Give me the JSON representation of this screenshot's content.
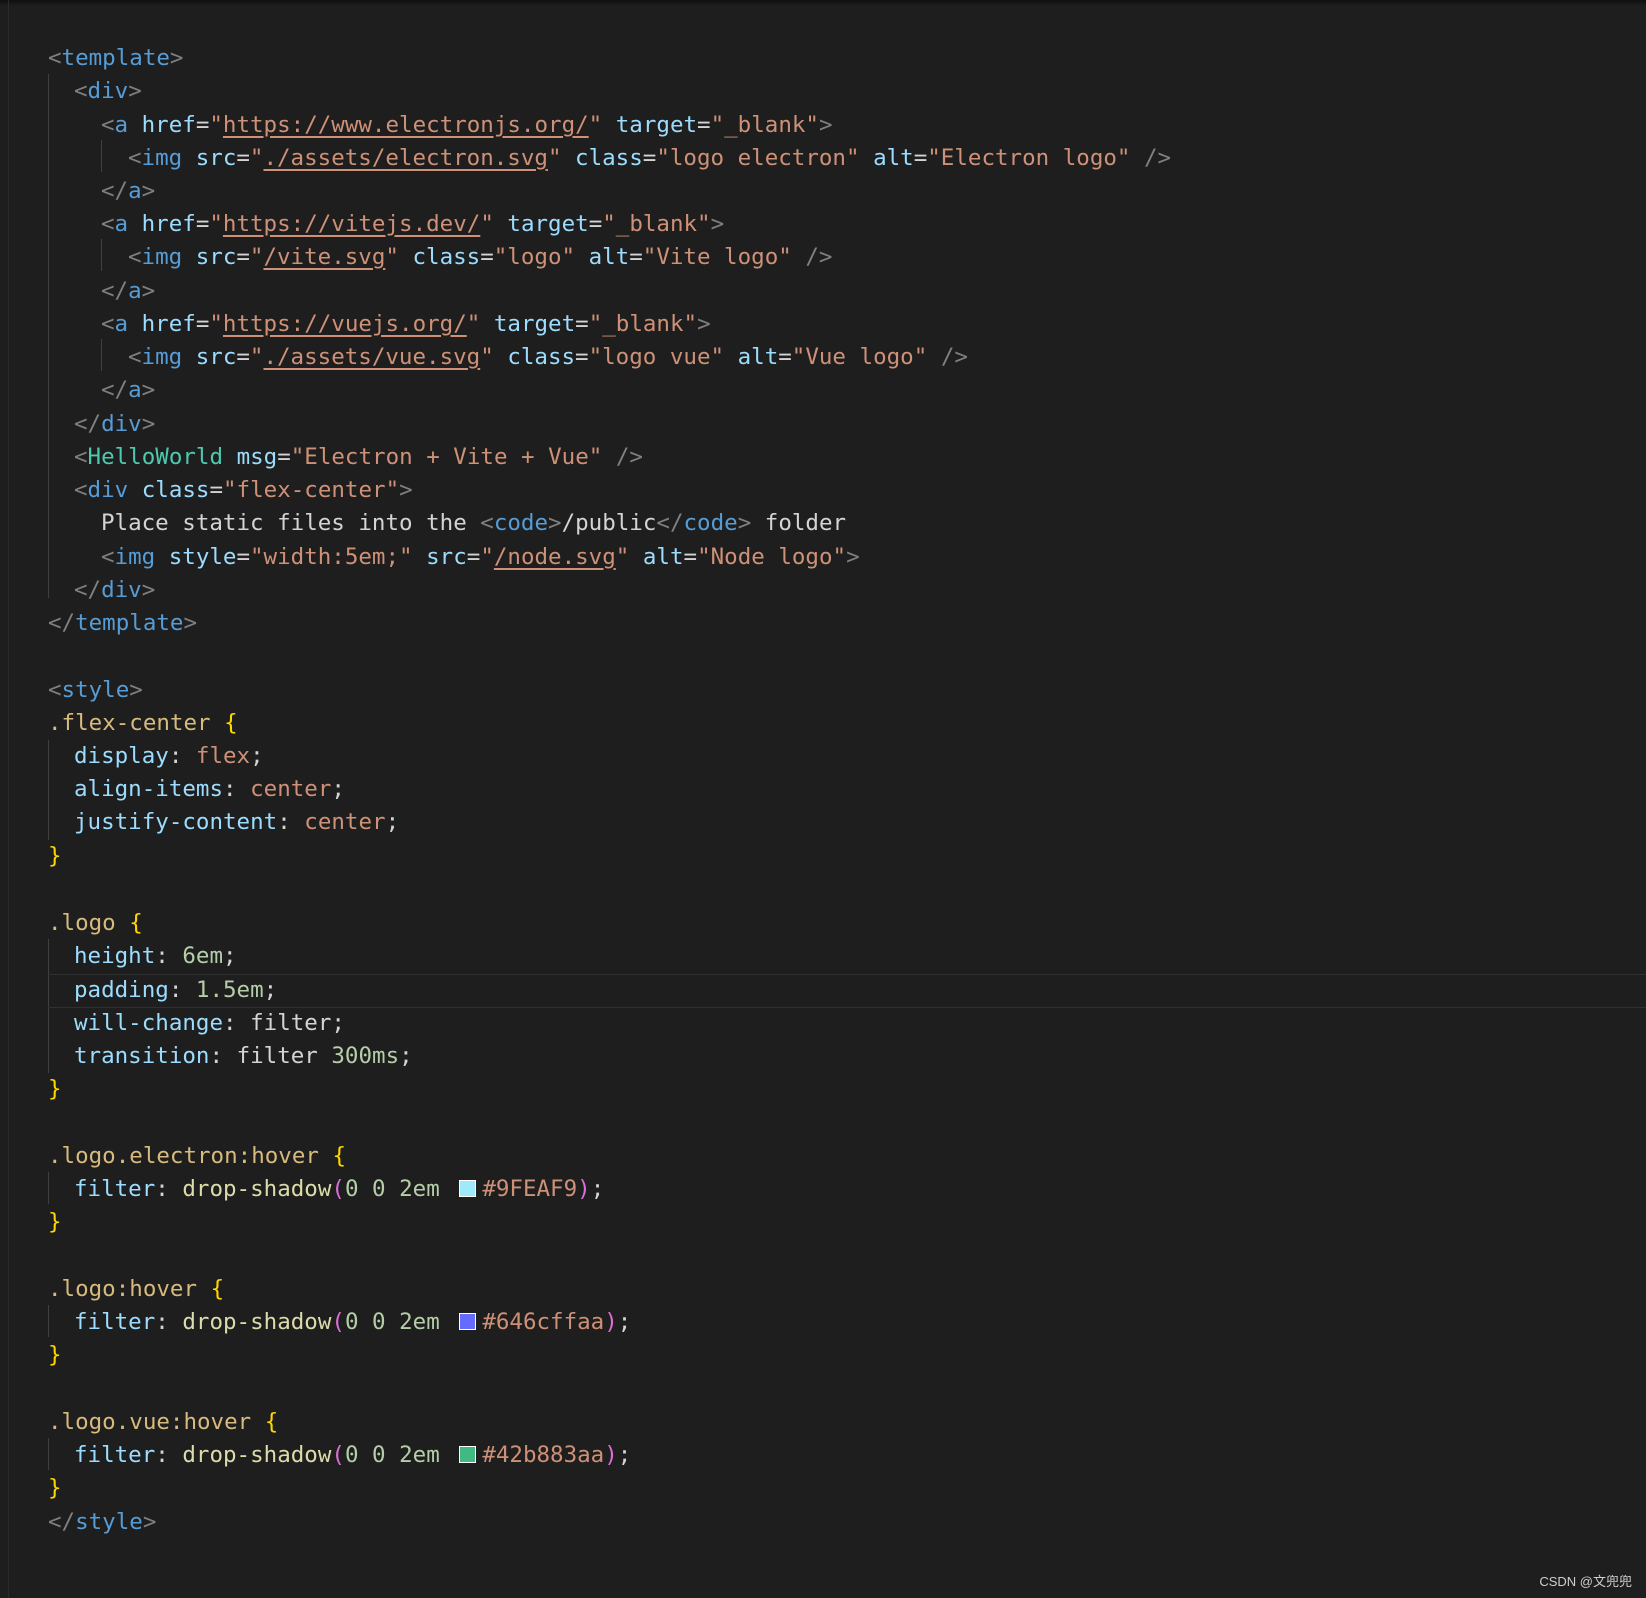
{
  "editor": {
    "language": "vue",
    "theme_colors": {
      "background": "#1e1e1e",
      "tag": "#569cd6",
      "attribute": "#9cdcfe",
      "string": "#ce9178",
      "selector": "#d7ba7d",
      "brace": "#ffd700"
    }
  },
  "code": {
    "template_open": "template",
    "div": "div",
    "a": "a",
    "img": "img",
    "href": "href",
    "target": "target",
    "blank": "\"_blank\"",
    "src": "src",
    "class": "class",
    "alt": "alt",
    "url_electron": "https://www.electronjs.org/",
    "src_electron": "./assets/electron.svg",
    "class_electron": "\"logo electron\"",
    "alt_electron": "\"Electron logo\"",
    "url_vite": "https://vitejs.dev/",
    "src_vite": "/vite.svg",
    "class_vite": "\"logo\"",
    "alt_vite": "\"Vite logo\"",
    "url_vue": "https://vuejs.org/",
    "src_vue": "./assets/vue.svg",
    "class_vue": "\"logo vue\"",
    "alt_vue": "\"Vue logo\"",
    "helloworld": "HelloWorld",
    "msg": "msg",
    "msg_value": "\"Electron + Vite + Vue\"",
    "flex_center_class": "\"flex-center\"",
    "place_text": "Place static files into the ",
    "code_tag": "code",
    "public_text": "/public",
    "folder_text": " folder",
    "style_attr": "style",
    "style_value": "\"width:5em;\"",
    "src_node": "/node.svg",
    "alt_node": "\"Node logo\"",
    "style_tag": "style",
    "sel_flex_center": ".flex-center",
    "prop_display": "display",
    "val_flex": "flex",
    "prop_align_items": "align-items",
    "val_center": "center",
    "prop_justify_content": "justify-content",
    "sel_logo": ".logo",
    "prop_height": "height",
    "val_6em": "6em",
    "prop_padding": "padding",
    "val_1_5em": "1.5em",
    "prop_will_change": "will-change",
    "val_filter": "filter",
    "prop_transition": "transition",
    "val_filter_word": "filter ",
    "val_300ms": "300ms",
    "sel_logo_electron_hover": ".logo.electron:hover",
    "prop_filter": "filter",
    "fn_drop_shadow": "drop-shadow",
    "shadow_args": "0 0 2em",
    "color_electron": "#9FEAF9",
    "sel_logo_hover": ".logo:hover",
    "color_logo": "#646cffaa",
    "sel_logo_vue_hover": ".logo.vue:hover",
    "color_vue": "#42b883aa"
  },
  "swatches": {
    "electron": "#9FEAF9",
    "logo": "#646cff",
    "vue": "#42b883"
  },
  "watermark": "CSDN @文兜兜"
}
